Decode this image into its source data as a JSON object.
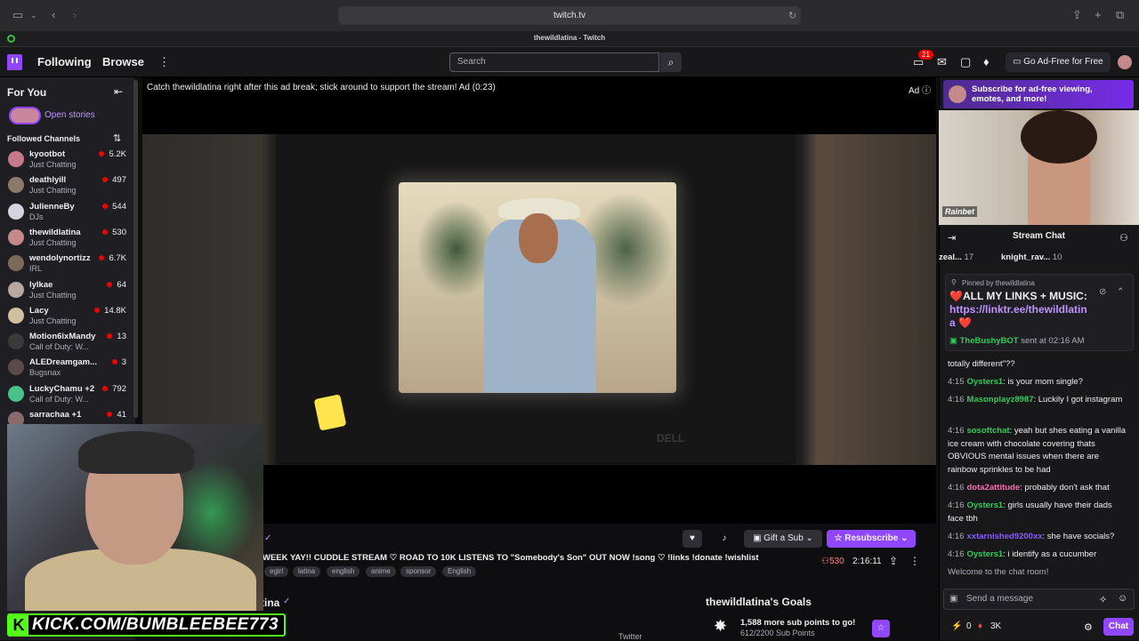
{
  "browser": {
    "url": "twitch.tv",
    "tab_title": "thewildlatina - Twitch"
  },
  "topnav": {
    "following": "Following",
    "browse": "Browse",
    "search_placeholder": "Search",
    "notif_count": "21",
    "adfree": "Go Ad-Free for Free"
  },
  "sidebar": {
    "header": "For You",
    "open_stories": "Open stories",
    "followed_channels": "Followed Channels",
    "channels": [
      {
        "name": "kyootbot",
        "game": "Just Chatting",
        "viewers": "5.2K",
        "color": "#c47a8a"
      },
      {
        "name": "deathlyill",
        "game": "Just Chatting",
        "viewers": "497",
        "color": "#8a7a6a"
      },
      {
        "name": "JulienneBy",
        "game": "DJs",
        "viewers": "544",
        "color": "#d4d4e0"
      },
      {
        "name": "thewildlatina",
        "game": "Just Chatting",
        "viewers": "530",
        "color": "#c48a8a"
      },
      {
        "name": "wendolynortizz",
        "game": "IRL",
        "viewers": "6.7K",
        "color": "#7a6a5a"
      },
      {
        "name": "lylkae",
        "game": "Just Chatting",
        "viewers": "64",
        "color": "#b8a8a0"
      },
      {
        "name": "Lacy",
        "game": "Just Chatting",
        "viewers": "14.8K",
        "color": "#d0c0a0"
      },
      {
        "name": "Motion6ixMandy",
        "game": "Call of Duty: W...",
        "viewers": "13",
        "color": "#3a3a3a"
      },
      {
        "name": "ALEDreamgam...",
        "game": "Bugsnax",
        "viewers": "3",
        "color": "#5a4a4a"
      },
      {
        "name": "LuckyChamu +2",
        "game": "Call of Duty: W...",
        "viewers": "792",
        "color": "#4ac08a"
      },
      {
        "name": "sarrachaa +1",
        "game": "",
        "viewers": "41",
        "color": "#8a6a6a"
      }
    ]
  },
  "ad": {
    "message": "Catch thewildlatina right after this ad break; stick around to support the stream! Ad (0:23)",
    "label": "Ad"
  },
  "video": {
    "tv_brand": "DELL",
    "overlay_text": "KICK.COM/BUMBLEEBEE773"
  },
  "stream": {
    "title": "WEEK YAY!! CUDDLE STREAM ♡ ROAD TO 10K LISTENS TO \"Somebody's Son\" OUT NOW !song ♡ !links !donate !wishlist",
    "tags": [
      "egirl",
      "latina",
      "english",
      "anime",
      "sponsor",
      "English"
    ],
    "viewers": "530",
    "uptime": "2:16:11",
    "gift_label": "Gift a Sub",
    "resub_label": "Resubscribe",
    "channel_partial": "tina",
    "twitter": "Twitter",
    "goals_title": "thewildlatina's Goals",
    "goal_line": "1,588 more sub points to go!",
    "goal_sub": "612/2200 Sub Points"
  },
  "chat": {
    "sub_banner": "Subscribe for ad-free viewing, emotes, and more!",
    "ad_brand": "Rainbet",
    "header": "Stream Chat",
    "leaders": [
      {
        "name": "zeal...",
        "count": "17"
      },
      {
        "name": "knight_rav...",
        "count": "10"
      }
    ],
    "pinned_by": "Pinned by thewildlatina",
    "pinned_msg": "❤️ALL MY LINKS + MUSIC:",
    "pinned_link": "https://linktr.ee/thewildlatin",
    "pinned_link2": "a",
    "pinned_heart": "❤️",
    "pinned_sender": "TheBushyBOT",
    "pinned_sent": " sent at 02:16 AM",
    "messages": [
      {
        "ts": "",
        "user": "",
        "color": "#efeff1",
        "text": "totally different\"??"
      },
      {
        "ts": "4:15",
        "user": "Oysters1",
        "color": "#2fcc5a",
        "text": ": is your mom single?"
      },
      {
        "ts": "4:16",
        "user": "Masonplayz8987",
        "color": "#2fcc5a",
        "text": ": Luckily I got instagram"
      },
      {
        "ts": "4:16",
        "user": "sosoftchat",
        "color": "#2fcc5a",
        "text": ": yeah but shes eating a vanilla ice cream with chocolate covering thats OBVIOUS mental issues when there are rainbow sprinkles to be had"
      },
      {
        "ts": "4:16",
        "user": "dota2attitude",
        "color": "#ff69b4",
        "text": ": probably don't ask that"
      },
      {
        "ts": "4:16",
        "user": "Oysters1",
        "color": "#2fcc5a",
        "text": ": girls usually have their dads face tbh"
      },
      {
        "ts": "4:16",
        "user": "xxtarnished9200xx",
        "color": "#8a5cf6",
        "text": ": she have socials?"
      },
      {
        "ts": "4:16",
        "user": "Oysters1",
        "color": "#2fcc5a",
        "text": ": i identify as a cucumber"
      },
      {
        "ts": "",
        "user": "",
        "color": "#adadb8",
        "text": "Welcome to the chat room!"
      }
    ],
    "input_placeholder": "Send a message",
    "points": "0",
    "bits": "3K",
    "chat_button": "Chat"
  }
}
